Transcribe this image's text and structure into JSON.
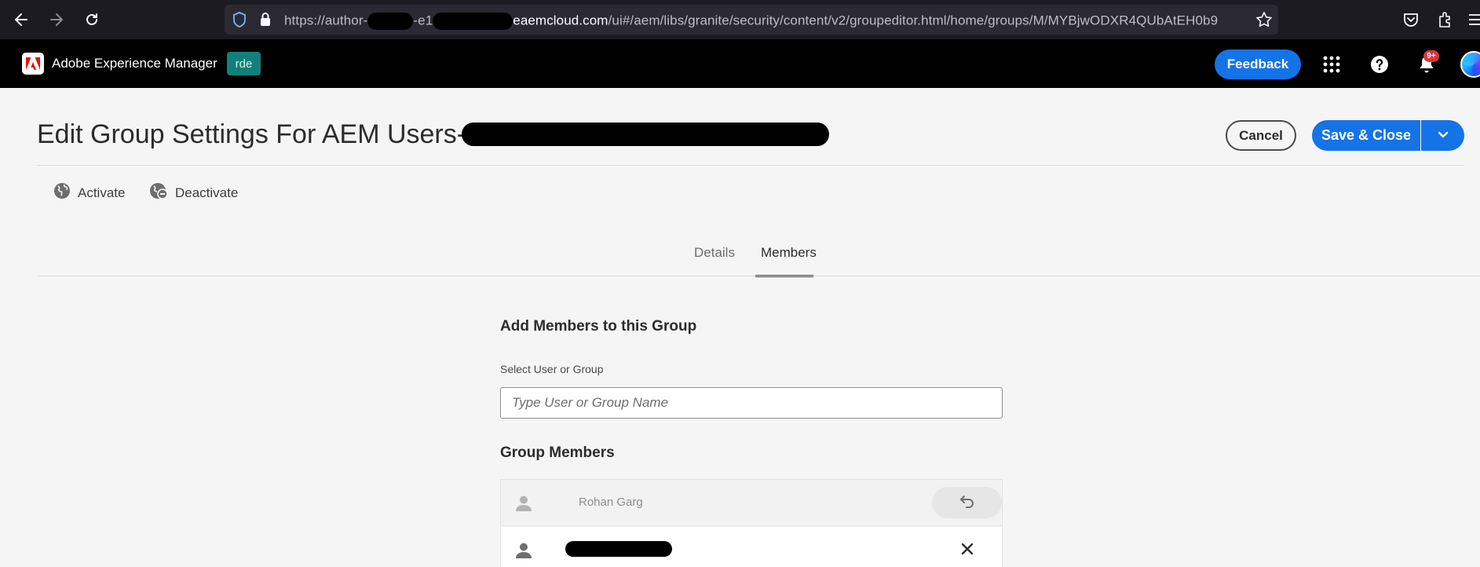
{
  "browser": {
    "url_prefix": "https://author-",
    "url_mid": "-e1",
    "url_host": "eaemcloud.com",
    "url_path": "/ui#/aem/libs/granite/security/content/v2/groupeditor.html/home/groups/M/MYBjwODXR4QUbAtEH0b9"
  },
  "header": {
    "app_name": "Adobe Experience Manager",
    "env_badge": "rde",
    "feedback_label": "Feedback",
    "notification_count": "9+"
  },
  "page": {
    "title": "Edit Group Settings For AEM Users-ab37",
    "cancel_label": "Cancel",
    "save_label": "Save & Close"
  },
  "actions": {
    "activate_label": "Activate",
    "deactivate_label": "Deactivate"
  },
  "tabs": [
    {
      "label": "Details",
      "active": false
    },
    {
      "label": "Members",
      "active": true
    }
  ],
  "members_panel": {
    "add_heading": "Add Members to this Group",
    "select_label": "Select User or Group",
    "search_placeholder": "Type User or Group Name",
    "group_members_heading": "Group Members",
    "members": [
      {
        "name": "Rohan Garg",
        "state": "removed"
      },
      {
        "name": "",
        "state": "current"
      }
    ]
  },
  "colors": {
    "primary_blue": "#1473e6",
    "env_badge": "#12807a",
    "notification": "#d7373f",
    "header_bg": "#000000"
  }
}
